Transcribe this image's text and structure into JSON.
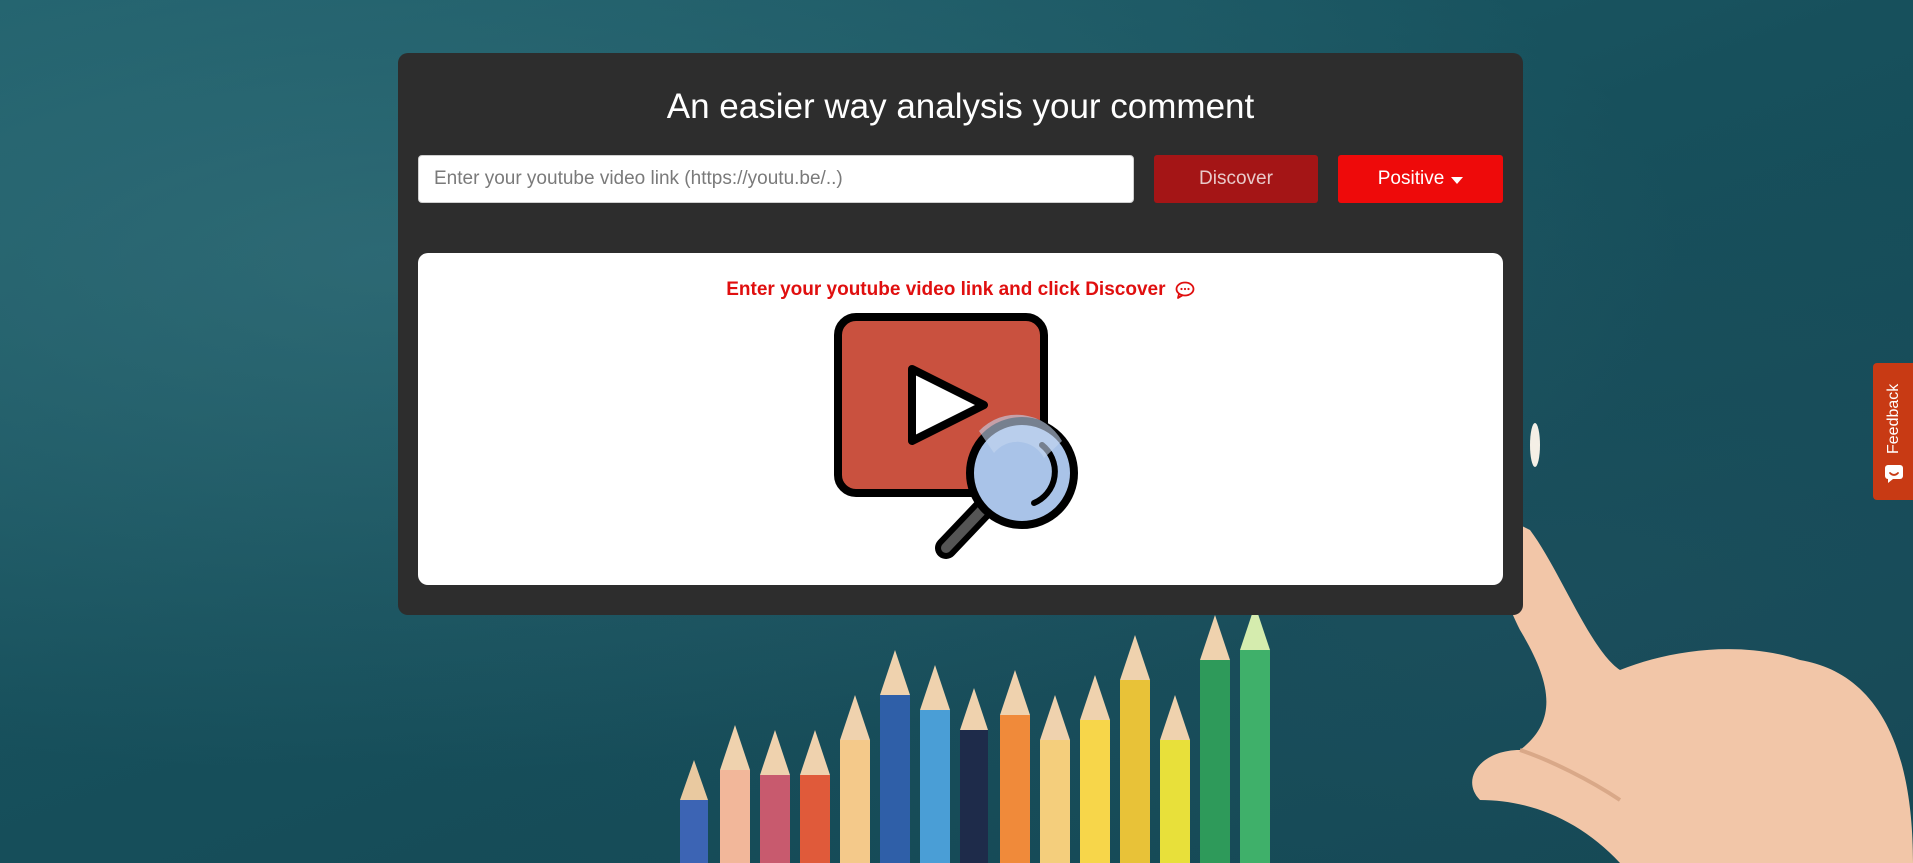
{
  "header": {
    "title": "An easier way analysis your comment"
  },
  "search": {
    "placeholder": "Enter your youtube video link (https://youtu.be/..)",
    "value": ""
  },
  "toolbar": {
    "discover_label": "Discover",
    "filter_label": "Positive"
  },
  "panel": {
    "message": "Enter your youtube video link and click Discover",
    "icons": [
      "chat-bubble-icon",
      "youtube-search-icon"
    ]
  },
  "feedback": {
    "label": "Feedback",
    "icon": "smile-icon"
  },
  "colors": {
    "card_bg": "#2d2d2d",
    "discover_bg": "#a41516",
    "filter_bg": "#ee0a0a",
    "message_text": "#e00f0f",
    "feedback_bg": "#c83a14",
    "play_box": "#c9513f",
    "magnifier_glass": "#a9c3e8"
  }
}
